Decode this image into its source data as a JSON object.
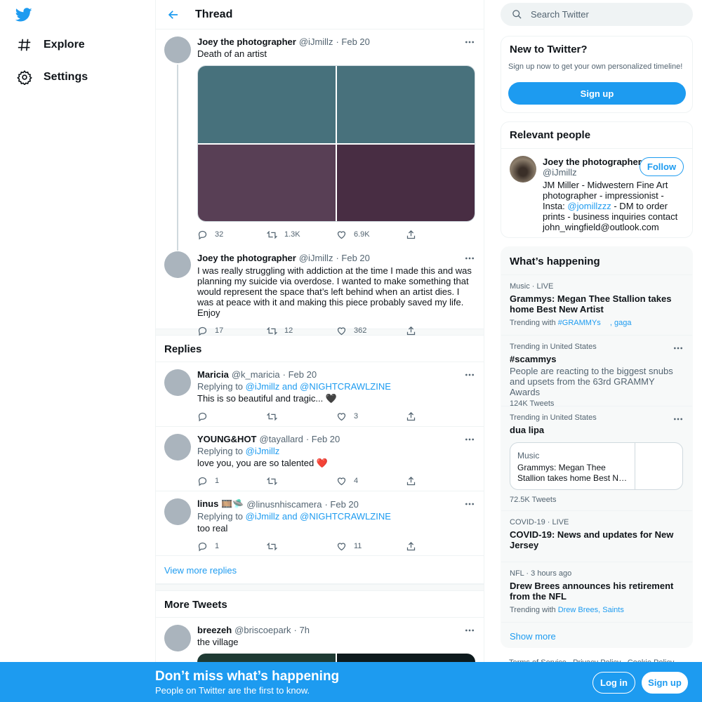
{
  "nav": {
    "logo_icon": "twitter-bird-icon",
    "items": [
      {
        "label": "Explore",
        "icon": "hashtag-icon"
      },
      {
        "label": "Settings",
        "icon": "gear-icon"
      }
    ]
  },
  "header": {
    "title": "Thread",
    "back_icon": "arrow-left-icon"
  },
  "thread": [
    {
      "name": "Joey the photographer",
      "handle": "@iJmillz",
      "date": "· Feb 20",
      "text": "Death of an artist",
      "media_colors": [
        "#47717c",
        "#48717c",
        "#583f55",
        "#482d43"
      ],
      "replies": "32",
      "retweets": "1.3K",
      "likes": "6.9K"
    },
    {
      "name": "Joey the photographer",
      "handle": "@iJmillz",
      "date": "· Feb 20",
      "text": "I was really struggling with addiction at the time I made this and was planning my suicide via overdose. I wanted to make something that would represent the space that’s left behind when an artist dies. I was at peace with it and making this piece probably saved my life. Enjoy",
      "replies": "17",
      "retweets": "12",
      "likes": "362"
    }
  ],
  "replies_section": {
    "title": "Replies",
    "items": [
      {
        "name": "Maricia",
        "handle": "@k_maricia",
        "date": "· Feb 20",
        "replying_prefix": "Replying to",
        "replying_to": "@iJmillz and @NIGHTCRAWLZINE",
        "text": "This is so beautiful and tragic... 🖤",
        "replies": "",
        "retweets": "",
        "likes": "3"
      },
      {
        "name": "YOUNG&HOT",
        "handle": "@tayallard",
        "date": "· Feb 20",
        "replying_prefix": "Replying to",
        "replying_to": "@iJmillz",
        "text": "love you, you are so talented ❤️",
        "replies": "1",
        "retweets": "",
        "likes": "4"
      },
      {
        "name": "linus 🎞️🛸",
        "handle": "@linusnhiscamera",
        "date": "· Feb 20",
        "replying_prefix": "Replying to",
        "replying_to": "@iJmillz and @NIGHTCRAWLZINE",
        "text": "too real",
        "replies": "1",
        "retweets": "",
        "likes": "11"
      }
    ],
    "view_more": "View more replies"
  },
  "more_tweets": {
    "title": "More Tweets",
    "tweet": {
      "name": "breezeh",
      "handle": "@briscoepark",
      "date": "· 7h",
      "text": "the village"
    }
  },
  "search": {
    "placeholder": "Search Twitter"
  },
  "new_to_twitter": {
    "title": "New to Twitter?",
    "text": "Sign up now to get your own personalized timeline!",
    "button": "Sign up"
  },
  "relevant_people": {
    "title": "Relevant people",
    "name": "Joey the photographer",
    "handle": "@iJmillz",
    "follow": "Follow",
    "bio_before": "JM Miller - Midwestern Fine Art photographer - impressionist - Insta:",
    "bio_link": "@jomillzzz",
    "bio_after": "- DM to order prints - business inquiries contact john_wingfield@outlook.com"
  },
  "happening": {
    "title": "What’s happening",
    "trends": [
      {
        "category": "Music · LIVE",
        "title": "Grammys: Megan Thee Stallion takes home Best New Artist",
        "trending_with_label": "Trending with",
        "trending_with": "#GRAMMYs",
        "trending_with_2": ", gaga"
      },
      {
        "category": "Trending in United States",
        "title": "#scammys",
        "desc": "People are reacting to the biggest snubs and upsets from the 63rd GRAMMY Awards",
        "count": "124K Tweets"
      },
      {
        "category": "Trending in United States",
        "title": "dua lipa",
        "card_category": "Music",
        "card_text": "Grammys: Megan Thee Stallion takes home Best N…",
        "count": "72.5K Tweets"
      },
      {
        "category": "COVID-19 · LIVE",
        "title": "COVID-19: News and updates for New Jersey"
      },
      {
        "category": "NFL · 3 hours ago",
        "title": "Drew Brees announces his retirement from the NFL",
        "trending_with_label": "Trending with",
        "trending_with": "Drew Brees, Saints"
      }
    ],
    "show_more": "Show more"
  },
  "footer_links": "Terms of Service   Privacy Policy   Cookie Policy",
  "bottom_bar": {
    "title": "Don’t miss what’s happening",
    "subtitle": "People on Twitter are the first to know.",
    "login": "Log in",
    "signup": "Sign up"
  },
  "colors": {
    "accent": "#1d9bf0",
    "text": "#0f1419",
    "muted": "#536471"
  }
}
